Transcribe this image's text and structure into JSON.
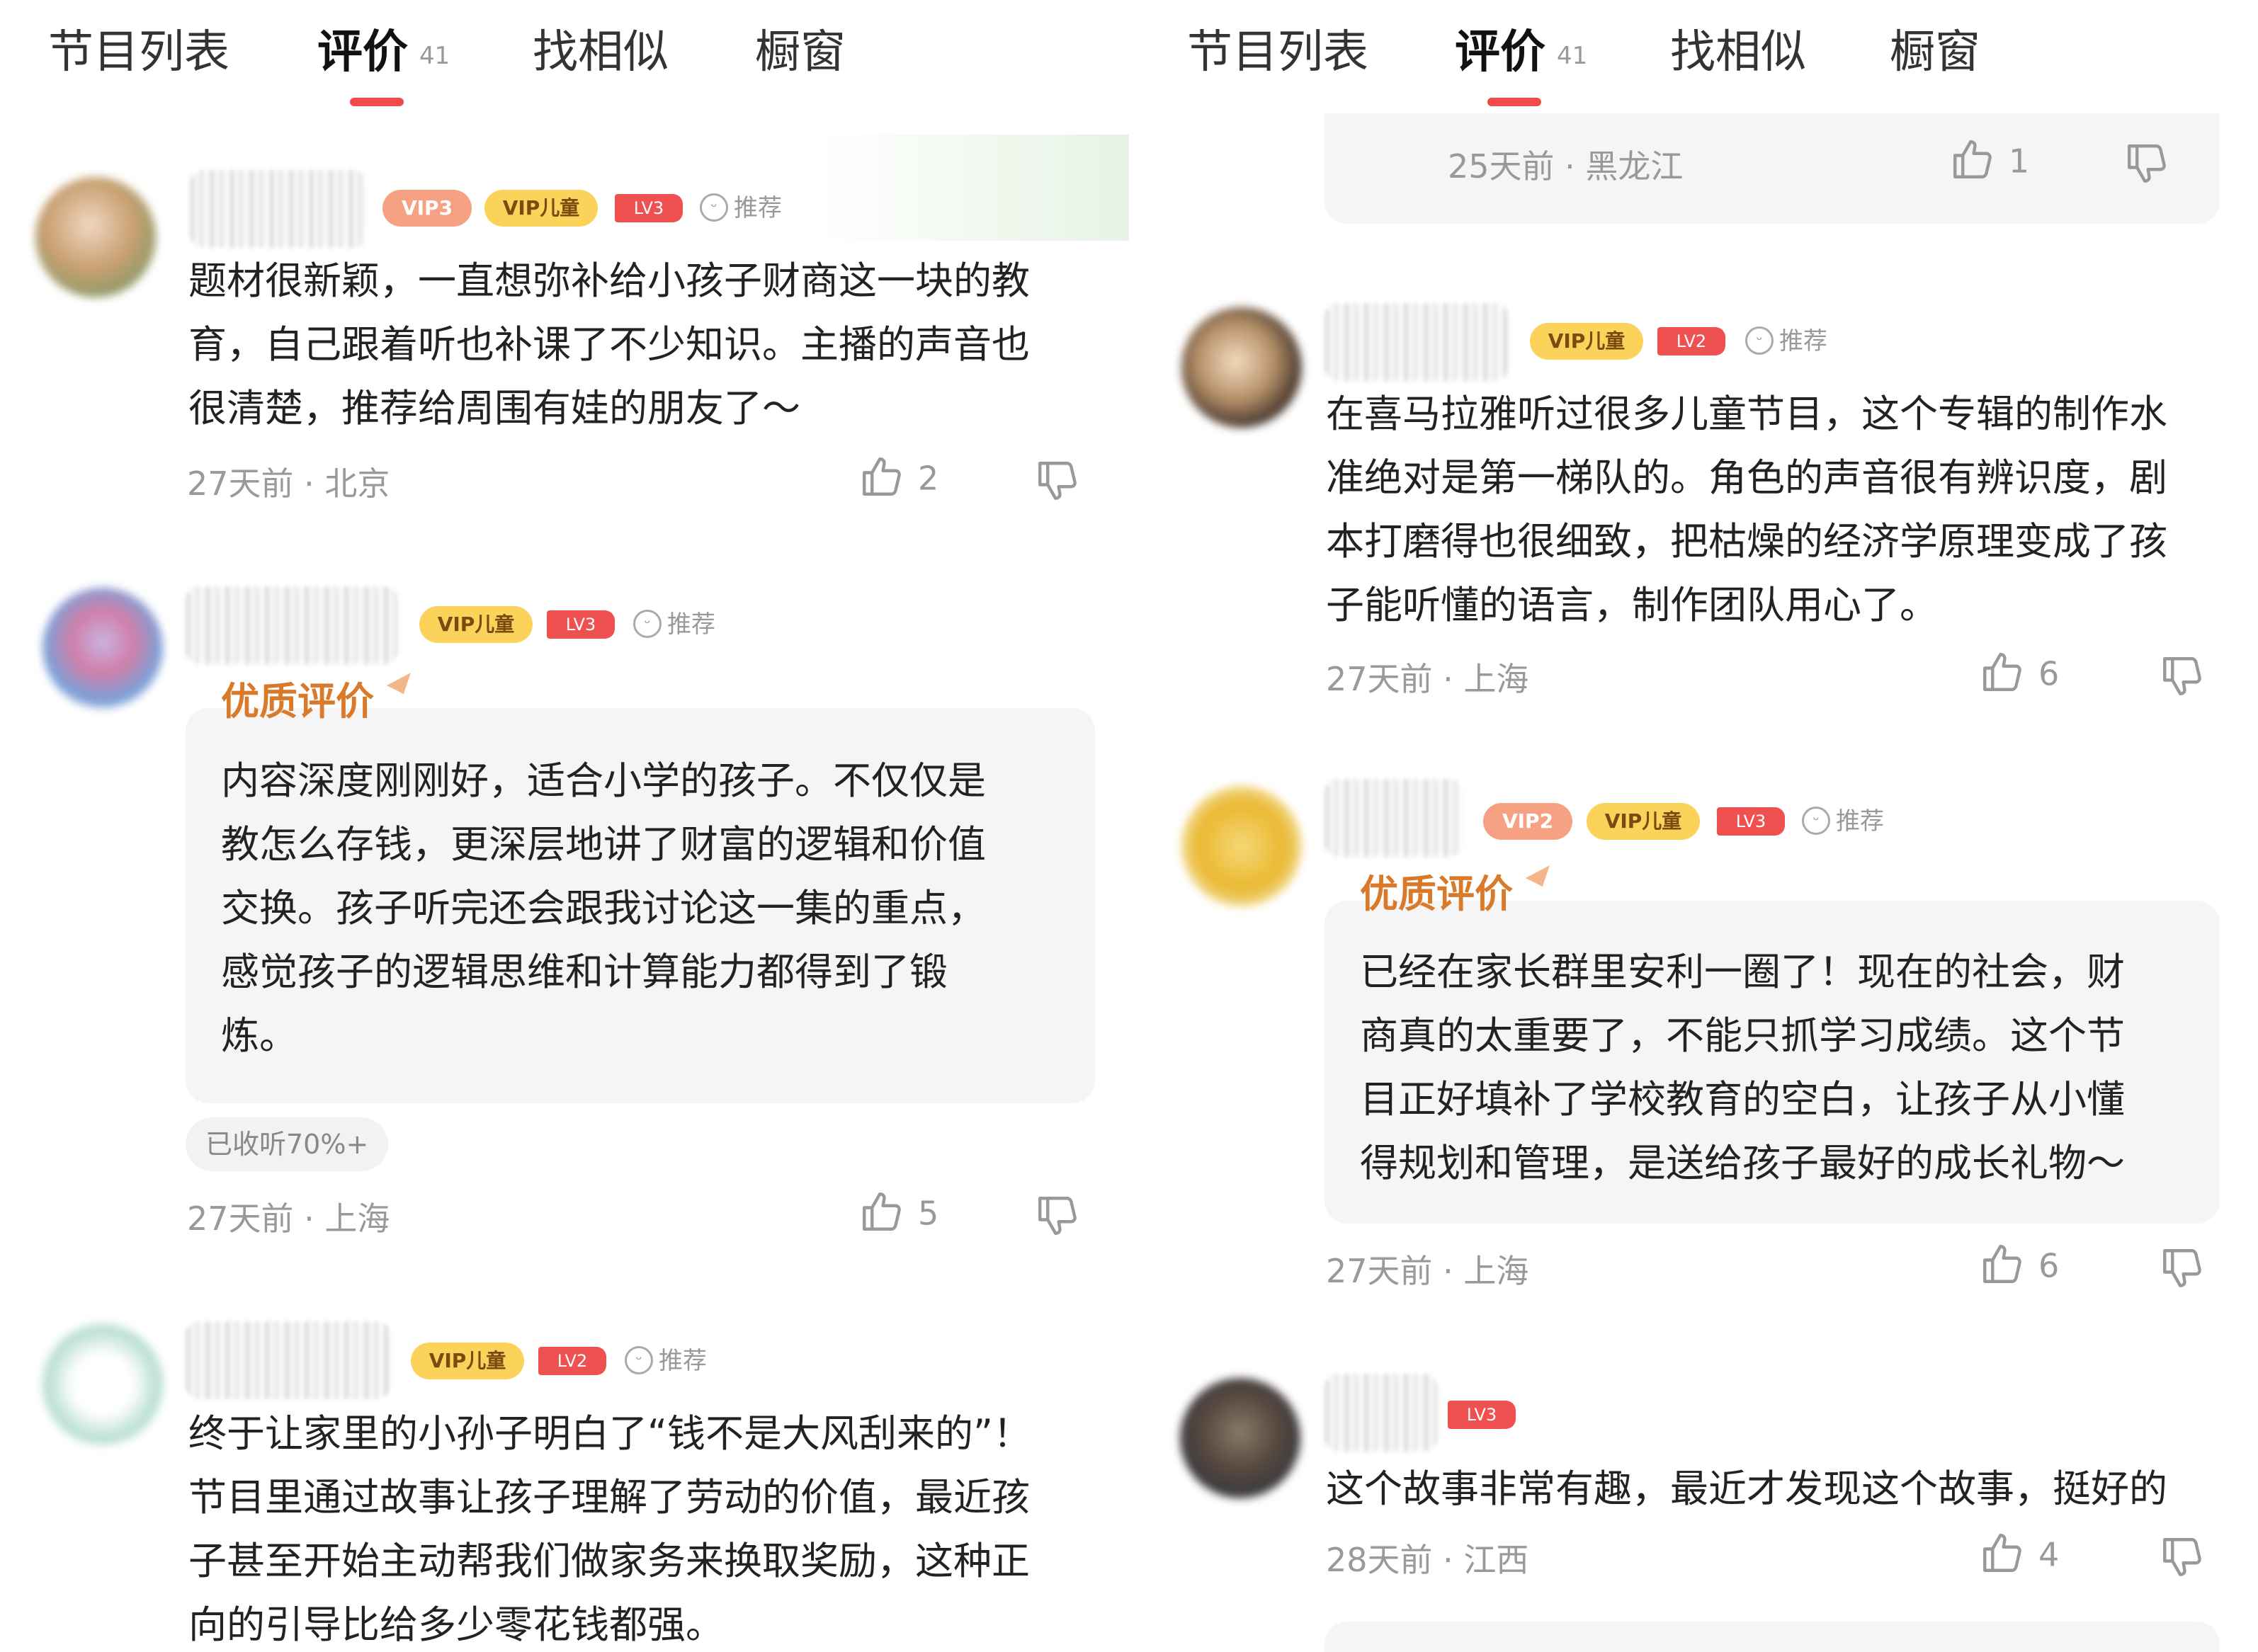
{
  "tabs": [
    {
      "label": "节目列表"
    },
    {
      "label": "评价",
      "count": "41"
    },
    {
      "label": "找相似"
    },
    {
      "label": "橱窗"
    }
  ],
  "left_panel": {
    "reviews": [
      {
        "badges": [
          "VIP3",
          "VIP儿童",
          "LV3"
        ],
        "recommend_label": "推荐",
        "text_lines": [
          "题材很新颖，一直想弥补给小孩子财商这一块的教",
          "育，自己跟着听也补课了不少知识。主播的声音也",
          "很清楚，推荐给周围有娃的朋友了～"
        ],
        "meta": "27天前 · 北京",
        "likes": "2"
      },
      {
        "badges": [
          "VIP儿童",
          "LV3"
        ],
        "recommend_label": "推荐",
        "quality_label": "优质评价",
        "text_lines": [
          "内容深度刚刚好，适合小学的孩子。不仅仅是",
          "教怎么存钱，更深层地讲了财富的逻辑和价值",
          "交换。孩子听完还会跟我讨论这一集的重点，",
          "感觉孩子的逻辑思维和计算能力都得到了锻",
          "炼。"
        ],
        "progress_pill": "已收听70%+",
        "meta": "27天前 · 上海",
        "likes": "5"
      },
      {
        "badges": [
          "VIP儿童",
          "LV2"
        ],
        "recommend_label": "推荐",
        "text_lines": [
          "终于让家里的小孙子明白了“钱不是大风刮来的”！",
          "节目里通过故事让孩子理解了劳动的价值，最近孩",
          "子甚至开始主动帮我们做家务来换取奖励，这种正",
          "向的引导比给多少零花钱都强。"
        ]
      }
    ]
  },
  "right_panel": {
    "top_card": {
      "meta": "25天前 · 黑龙江",
      "likes": "1"
    },
    "reviews": [
      {
        "badges": [
          "VIP儿童",
          "LV2"
        ],
        "recommend_label": "推荐",
        "text_lines": [
          "在喜马拉雅听过很多儿童节目，这个专辑的制作水",
          "准绝对是第一梯队的。角色的声音很有辨识度，剧",
          "本打磨得也很细致，把枯燥的经济学原理变成了孩",
          "子能听懂的语言，制作团队用心了。"
        ],
        "meta": "27天前 · 上海",
        "likes": "6"
      },
      {
        "badges": [
          "VIP2",
          "VIP儿童",
          "LV3"
        ],
        "recommend_label": "推荐",
        "quality_label": "优质评价",
        "text_lines": [
          "已经在家长群里安利一圈了！现在的社会，财",
          "商真的太重要了，不能只抓学习成绩。这个节",
          "目正好填补了学校教育的空白，让孩子从小懂",
          "得规划和管理，是送给孩子最好的成长礼物～"
        ],
        "meta": "27天前 · 上海",
        "likes": "6"
      },
      {
        "badges": [
          "LV3"
        ],
        "text_lines": [
          "这个故事非常有趣，最近才发现这个故事，挺好的"
        ],
        "meta": "28天前 · 江西",
        "likes": "4"
      }
    ]
  },
  "icons": [
    "thumb-up-icon",
    "thumb-down-icon",
    "recommend-face-icon"
  ],
  "colors": {
    "accent_red": "#f04a4a",
    "quality_orange": "#d97a2b",
    "vip_orange": "#f5a182",
    "vip_kid_yellow": "#fbd35b",
    "lv_red": "#ef5050"
  }
}
